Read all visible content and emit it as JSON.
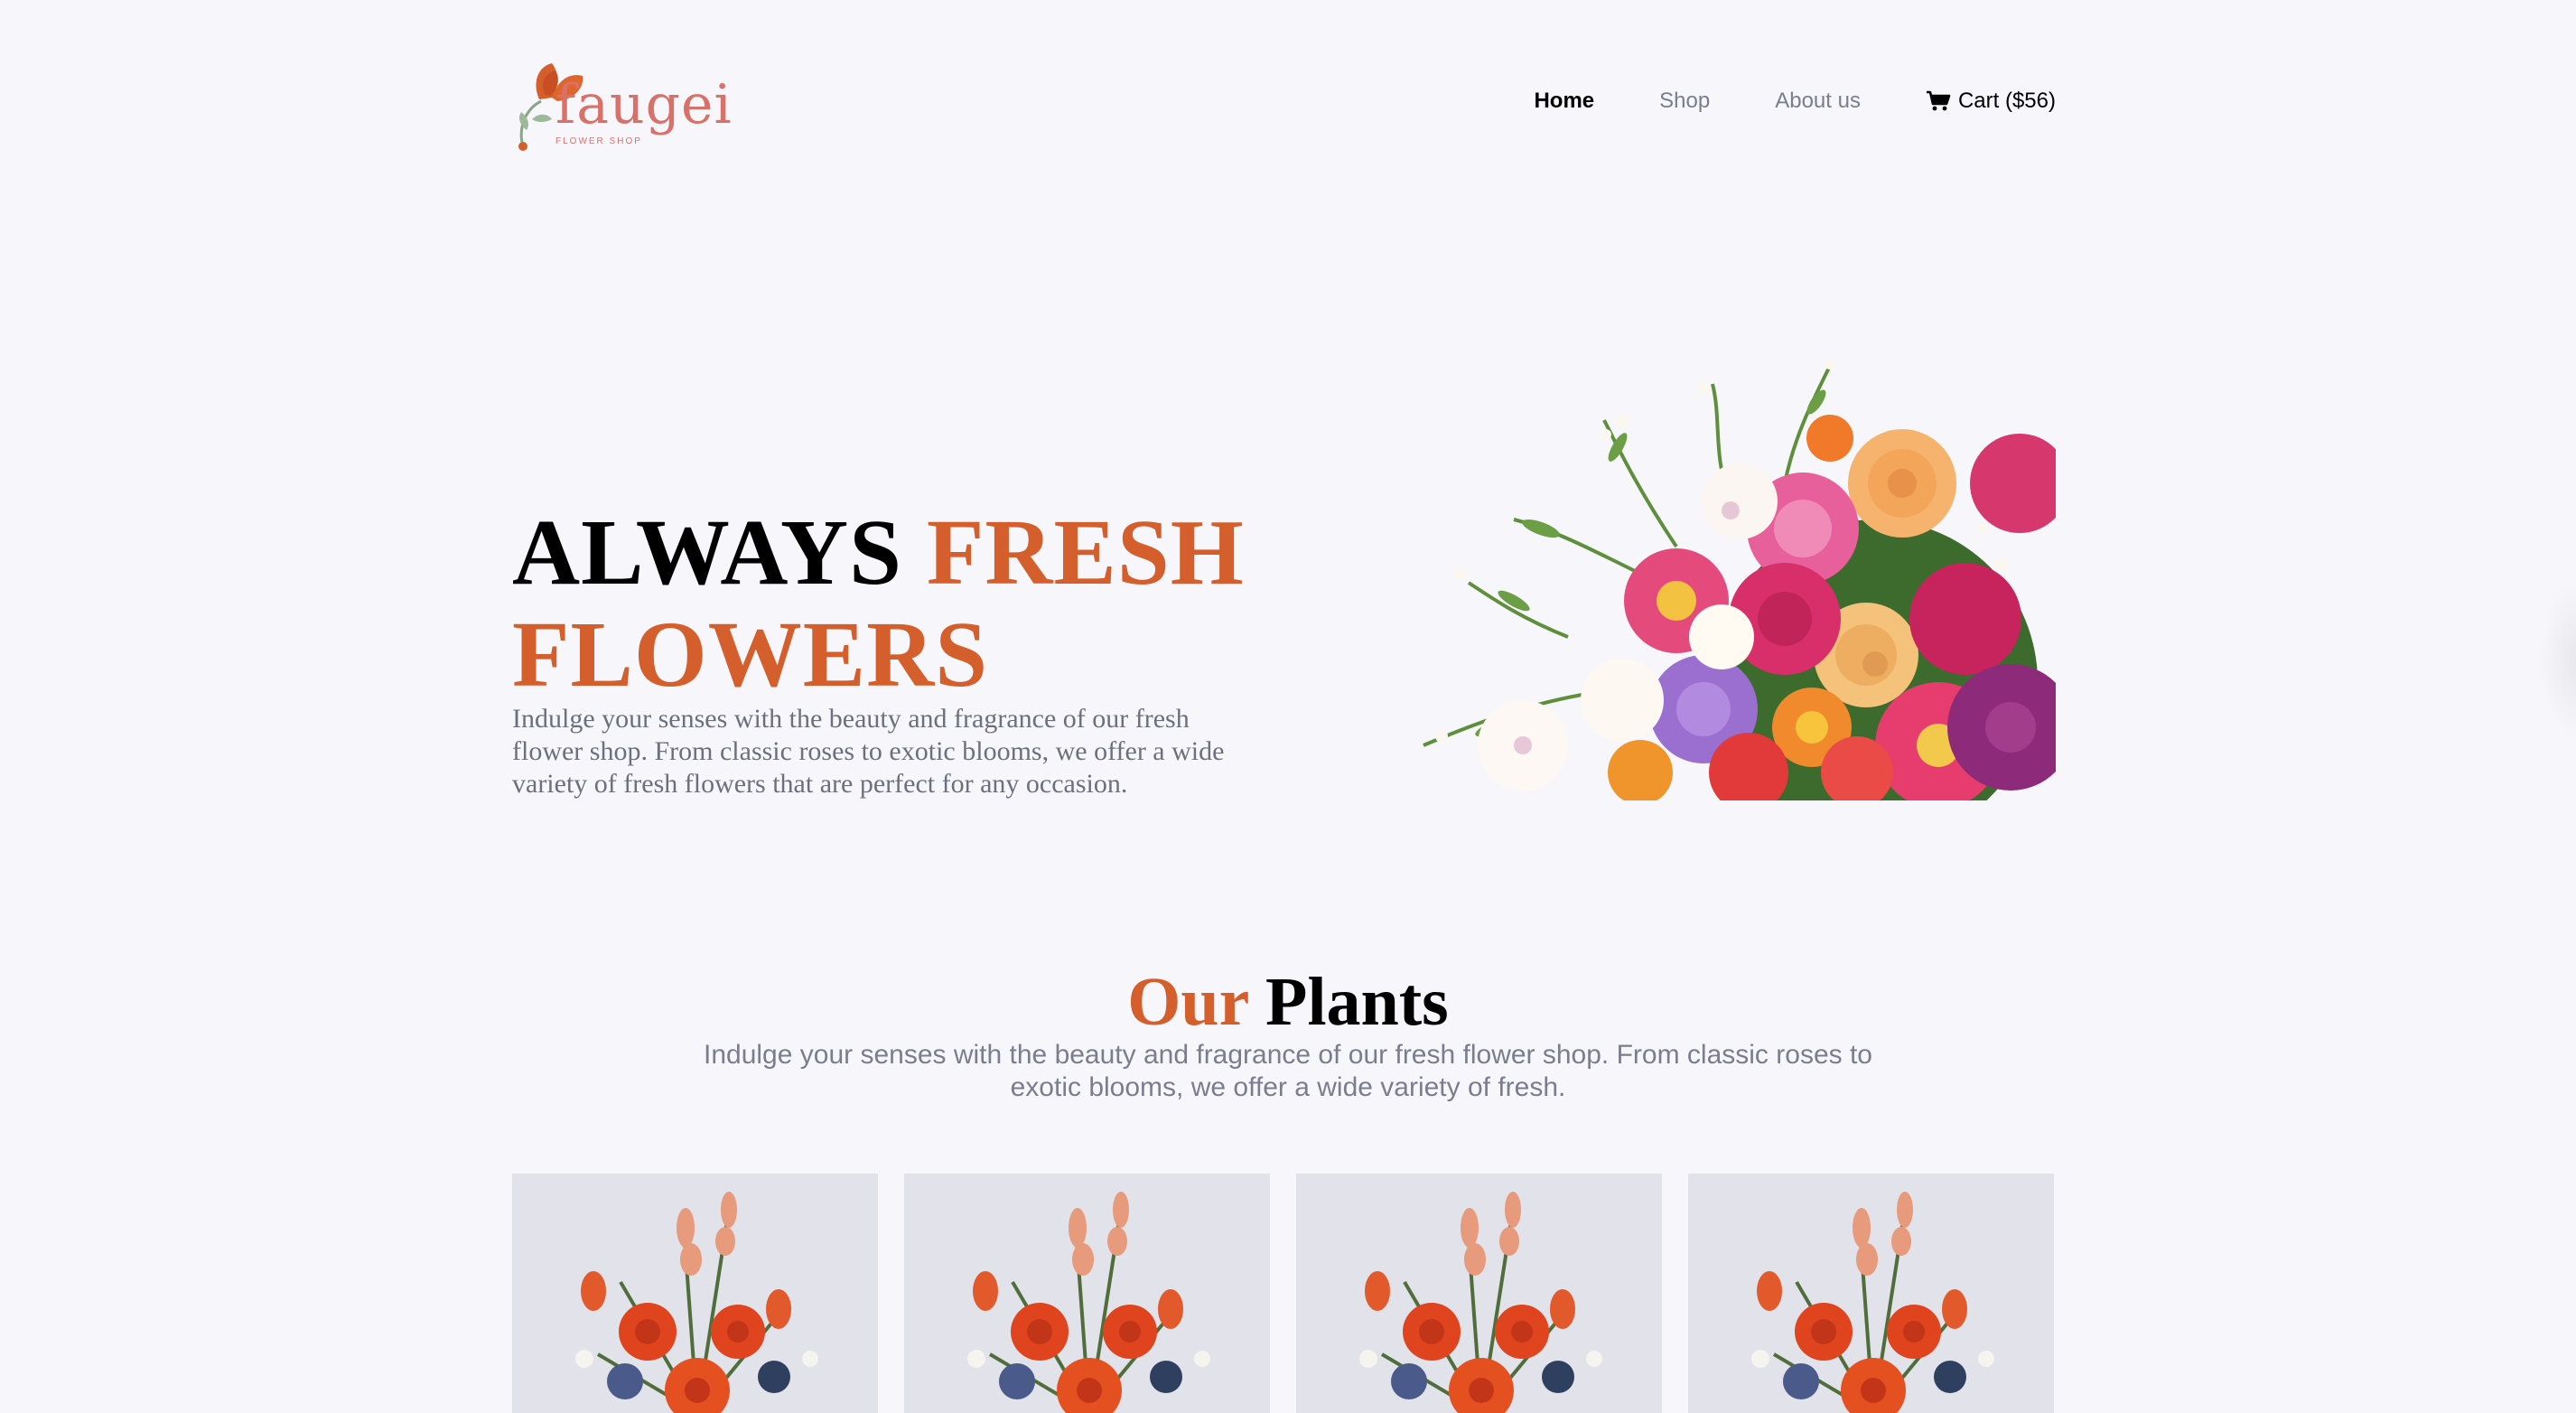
{
  "brand": {
    "name": "faugei",
    "tagline": "FLOWER SHOP",
    "colors": {
      "accent": "#d55f2c",
      "logo": "#d9716b",
      "background": "#f7f7fb",
      "muted_text": "#7b7d8e"
    }
  },
  "nav": {
    "items": [
      {
        "label": "Home",
        "active": true
      },
      {
        "label": "Shop",
        "active": false
      },
      {
        "label": "About us",
        "active": false
      }
    ],
    "cart": {
      "label": "Cart ($56)",
      "icon": "cart-icon"
    }
  },
  "hero": {
    "title_part1": "ALWAYS ",
    "title_part2": "FRESH FLOWERS",
    "text": "Indulge your senses with the beauty and fragrance of our fresh flower shop. From classic roses to exotic blooms, we offer a wide variety of fresh flowers that are perfect for any occasion.",
    "image": "flower-bouquet-image"
  },
  "plants": {
    "title_part1": "Our",
    "title_part2": "Plants",
    "text": "Indulge your senses with the beauty and fragrance of our fresh flower shop. From classic roses to exotic blooms, we offer a wide variety of fresh.",
    "cards": [
      {
        "image": "flower-vase-image"
      },
      {
        "image": "flower-vase-image"
      },
      {
        "image": "flower-vase-image"
      },
      {
        "image": "flower-vase-image"
      }
    ]
  }
}
